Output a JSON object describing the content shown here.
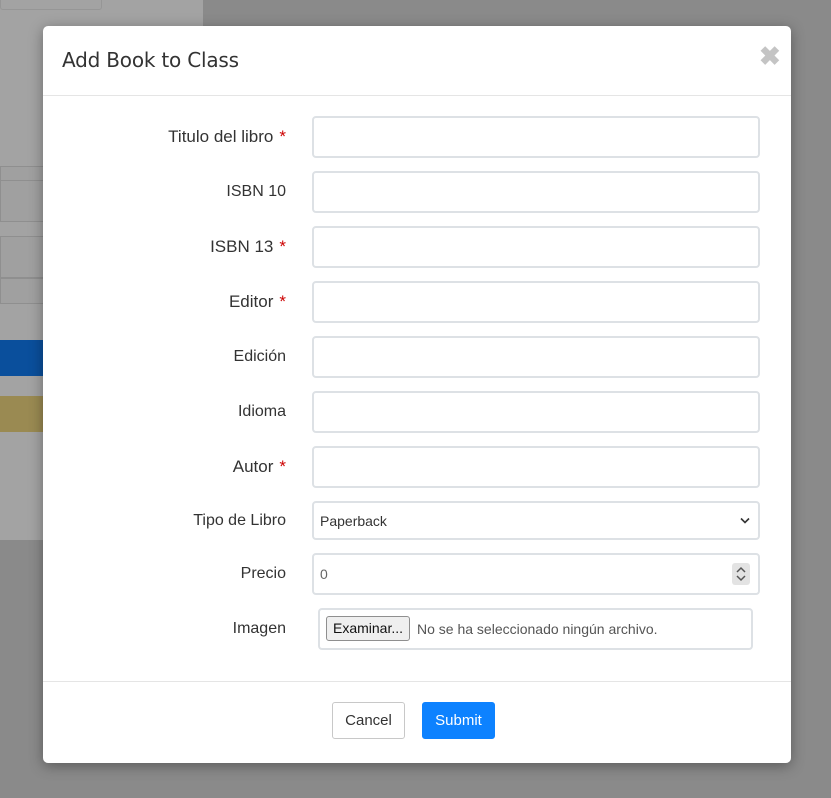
{
  "modal": {
    "title": "Add Book to Class",
    "close_icon": "close-icon",
    "required_mark": "*"
  },
  "form": {
    "fields": [
      {
        "label": "Titulo del libro",
        "required": true,
        "value": ""
      },
      {
        "label": "ISBN 10",
        "required": false,
        "value": ""
      },
      {
        "label": "ISBN 13",
        "required": true,
        "value": ""
      },
      {
        "label": "Editor",
        "required": true,
        "value": ""
      },
      {
        "label": "Edición",
        "required": false,
        "value": ""
      },
      {
        "label": "Idioma",
        "required": false,
        "value": ""
      },
      {
        "label": "Autor",
        "required": true,
        "value": ""
      }
    ],
    "book_type": {
      "label": "Tipo de Libro",
      "selected": "Paperback"
    },
    "price": {
      "label": "Precio",
      "value": "0"
    },
    "image": {
      "label": "Imagen",
      "button_label": "Examinar...",
      "status": "No se ha seleccionado ningún archivo."
    }
  },
  "footer": {
    "cancel_label": "Cancel",
    "submit_label": "Submit"
  },
  "colors": {
    "primary": "#0d82ff",
    "required": "#cc0000",
    "overlay": "#8a8a8a"
  }
}
